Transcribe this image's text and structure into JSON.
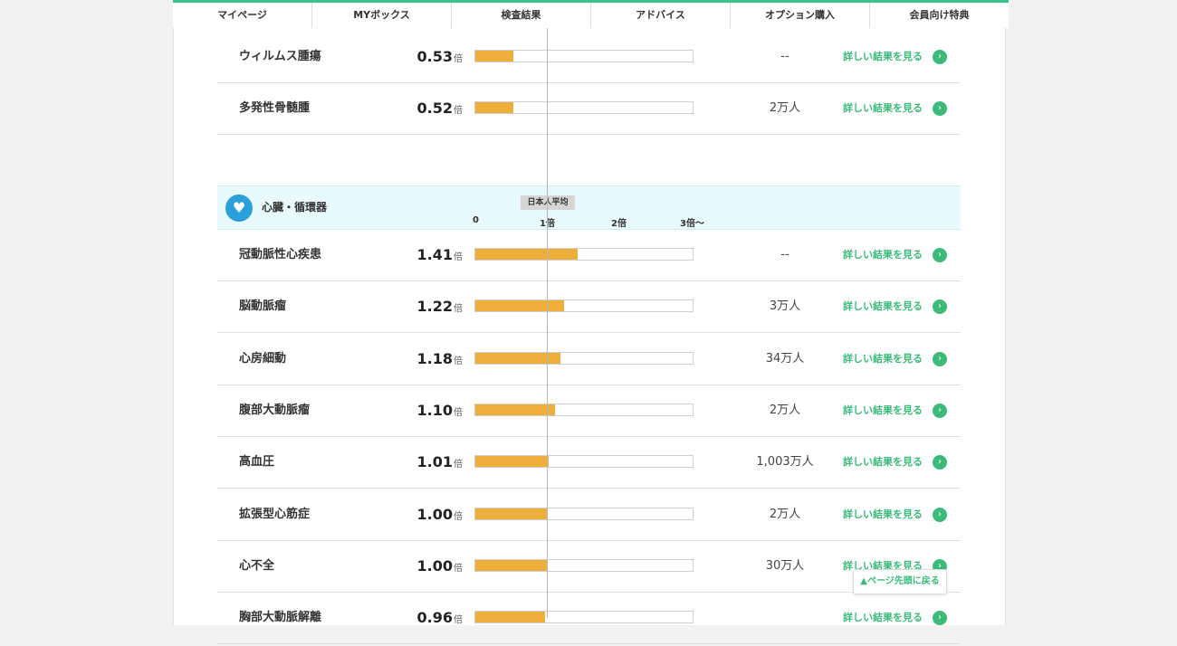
{
  "nav": {
    "items": [
      "マイページ",
      "MYボックス",
      "検査結果",
      "アドバイス",
      "オプション購入",
      "会員向け特典"
    ]
  },
  "unit": "倍",
  "detail_label": "詳しい結果を見る",
  "arrow_glyph": "›",
  "previous_rows": [
    {
      "name": "ウィルムス腫瘍",
      "ratio": "0.53",
      "ratio_value": 0.53,
      "patients": "--"
    },
    {
      "name": "多発性骨髄腫",
      "ratio": "0.52",
      "ratio_value": 0.52,
      "patients": "2万人"
    }
  ],
  "category": {
    "title": "心臓・循環器",
    "icon": "heart-icon",
    "icon_glyph": "♥",
    "average_label": "日本人平均",
    "scale_labels": [
      "0",
      "1倍",
      "2倍",
      "3倍〜"
    ],
    "rows": [
      {
        "name": "冠動脈性心疾患",
        "ratio": "1.41",
        "ratio_value": 1.41,
        "patients": "--"
      },
      {
        "name": "脳動脈瘤",
        "ratio": "1.22",
        "ratio_value": 1.22,
        "patients": "3万人"
      },
      {
        "name": "心房細動",
        "ratio": "1.18",
        "ratio_value": 1.18,
        "patients": "34万人"
      },
      {
        "name": "腹部大動脈瘤",
        "ratio": "1.10",
        "ratio_value": 1.1,
        "patients": "2万人"
      },
      {
        "name": "高血圧",
        "ratio": "1.01",
        "ratio_value": 1.01,
        "patients": "1,003万人"
      },
      {
        "name": "拡張型心筋症",
        "ratio": "1.00",
        "ratio_value": 1.0,
        "patients": "2万人"
      },
      {
        "name": "心不全",
        "ratio": "1.00",
        "ratio_value": 1.0,
        "patients": "30万人"
      },
      {
        "name": "胸部大動脈解離",
        "ratio": "0.96",
        "ratio_value": 0.96,
        "patients": ""
      }
    ]
  },
  "back_to_top": "▲ページ先頭に戻る",
  "colors": {
    "accent": "#3dba7b",
    "bar": "#eeae3c",
    "category_bg": "#e8fafc",
    "category_icon": "#2a9fd8"
  }
}
